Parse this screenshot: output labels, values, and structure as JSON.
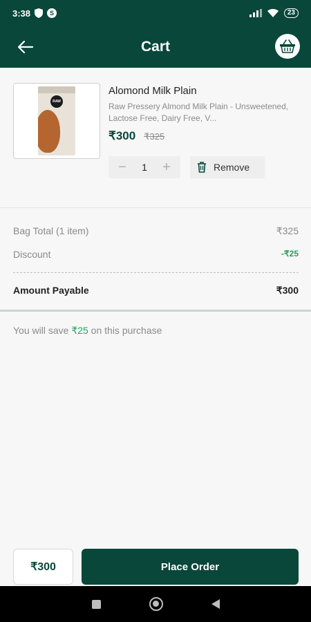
{
  "status_bar": {
    "time": "3:38",
    "battery": "23",
    "icons": [
      "shield-icon",
      "s-badge-icon",
      "signal-icon",
      "wifi-icon",
      "battery-icon"
    ]
  },
  "header": {
    "title": "Cart",
    "icons": [
      "back-arrow-icon",
      "basket-icon"
    ]
  },
  "product": {
    "name": "Alomond Milk Plain",
    "description": "Raw Pressery Almond Milk Plain - Unsweetened, Lactose Free, Dairy Free, V...",
    "price": "₹300",
    "mrp": "₹325",
    "quantity": "1",
    "decrement": "−",
    "increment": "+",
    "remove_label": "Remove",
    "image_brand": "RAW"
  },
  "bill": {
    "bag_total_label": "Bag Total (1 item)",
    "bag_total_value": "₹325",
    "discount_label": "Discount",
    "discount_value": "-₹25",
    "payable_label": "Amount Payable",
    "payable_value": "₹300"
  },
  "savings": {
    "prefix": "You will save ",
    "amount": "₹25",
    "suffix": " on this purchase"
  },
  "footer": {
    "total": "₹300",
    "place_order_label": "Place Order"
  },
  "colors": {
    "brand": "#08473a",
    "discount": "#2a9d5c"
  }
}
